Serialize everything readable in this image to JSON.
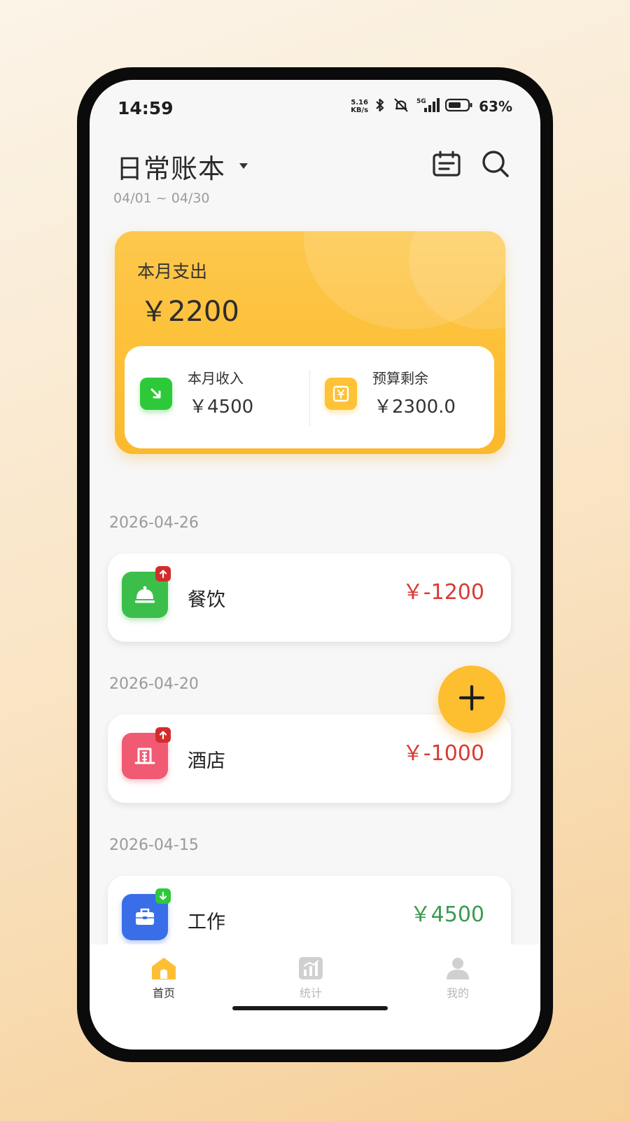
{
  "status_bar": {
    "time": "14:59",
    "net_speed_value": "5.16",
    "net_speed_unit": "KB/s",
    "network": "5G",
    "battery": "63%"
  },
  "header": {
    "book_name": "日常账本",
    "date_range": "04/01 ~ 04/30"
  },
  "summary": {
    "title": "本月支出",
    "amount": "￥2200",
    "income_label": "本月收入",
    "income_value": "￥4500",
    "budget_label": "预算剩余",
    "budget_value": "￥2300.0",
    "accent": "#fdc235"
  },
  "transactions": [
    {
      "date": "2026-04-26",
      "category": "餐饮",
      "amount": "￥-1200",
      "type": "expense",
      "icon": "dining-cloche-icon",
      "color": "#3cbf4a"
    },
    {
      "date": "2026-04-20",
      "category": "酒店",
      "amount": "￥-1000",
      "type": "expense",
      "icon": "hotel-building-icon",
      "color": "#f05a72"
    },
    {
      "date": "2026-04-15",
      "category": "工作",
      "amount": "￥4500",
      "type": "income",
      "icon": "briefcase-icon",
      "color": "#3a6ee8"
    }
  ],
  "colors": {
    "expense": "#d93a34",
    "income": "#3d9a52",
    "tab_active": "#fdbf35",
    "tab_inactive": "#c8c8c8"
  },
  "tabs": [
    {
      "label": "首页",
      "active": true,
      "icon": "home-icon"
    },
    {
      "label": "统计",
      "active": false,
      "icon": "stats-icon"
    },
    {
      "label": "我的",
      "active": false,
      "icon": "user-icon"
    }
  ]
}
